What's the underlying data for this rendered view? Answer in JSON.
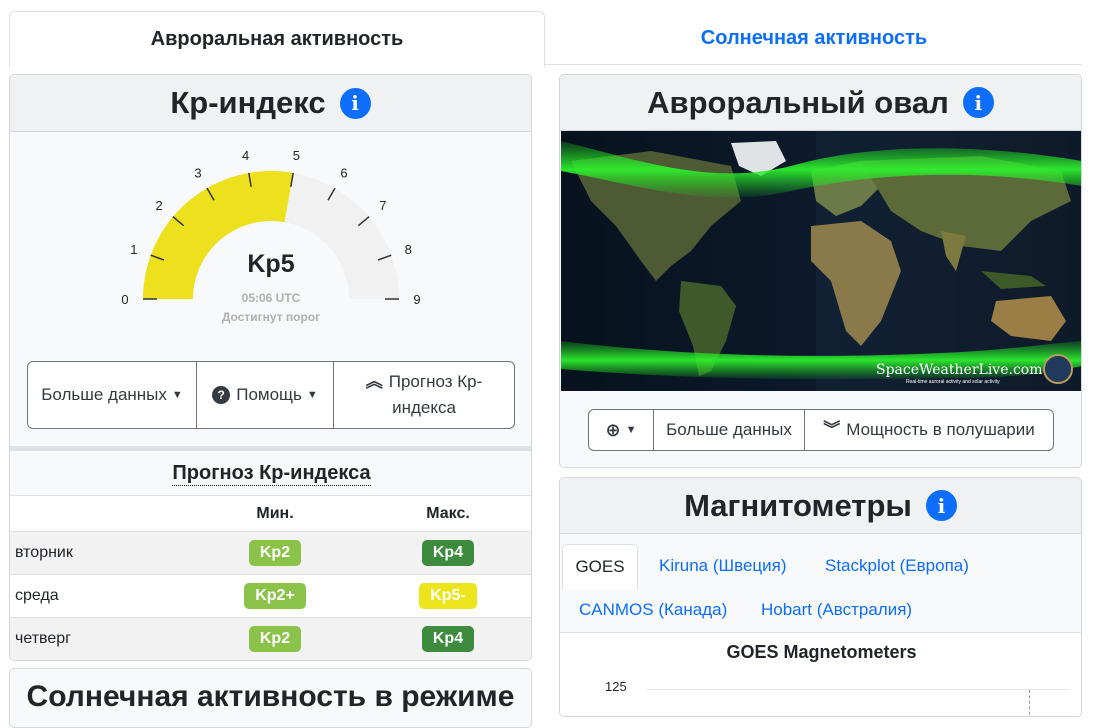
{
  "tabs": {
    "aurora": "Авроральная активность",
    "solar": "Солнечная активность"
  },
  "kp": {
    "title": "Кр-индекс",
    "gauge_ticks": [
      "0",
      "1",
      "2",
      "3",
      "4",
      "5",
      "6",
      "7",
      "8",
      "9"
    ],
    "current_value": 5,
    "value_label": "Kp5",
    "time": "05:06 UTC",
    "status": "Достигнут порог",
    "buttons": {
      "more": "Больше данных",
      "help": "Помощь",
      "forecast_line1": "Прогноз Кр-",
      "forecast_line2": "индекса"
    },
    "forecast": {
      "title": "Прогноз Кр-индекса",
      "col_min": "Мин.",
      "col_max": "Макс.",
      "rows": [
        {
          "day": "вторник",
          "min": "Kp2",
          "max": "Kp4",
          "min_color": "#8bc34a",
          "max_color": "#3d8b3d"
        },
        {
          "day": "среда",
          "min": "Kp2+",
          "max": "Kp5-",
          "min_color": "#8bc34a",
          "max_color": "#ede51c"
        },
        {
          "day": "четверг",
          "min": "Kp2",
          "max": "Kp4",
          "min_color": "#8bc34a",
          "max_color": "#3d8b3d"
        }
      ]
    },
    "next_card_title": "Солнечная активность в режиме"
  },
  "oval": {
    "title": "Авроральный овал",
    "watermark": "SpaceWeatherLive.com",
    "watermark_sub": "Real-time auroral activity and solar activity",
    "buttons": {
      "more": "Больше данных",
      "hemisphere": "Мощность в полушарии"
    }
  },
  "magnetometers": {
    "title": "Магнитометры",
    "tabs": [
      "GOES",
      "Kiruna (Швеция)",
      "Stackplot (Европа)",
      "CANMOS (Канада)",
      "Hobart (Австралия)"
    ],
    "active_tab": "GOES",
    "chart_title": "GOES Magnetometers",
    "y_tick": "125"
  },
  "colors": {
    "accent": "#0d6efd",
    "gauge_fill": "#ede11e"
  }
}
